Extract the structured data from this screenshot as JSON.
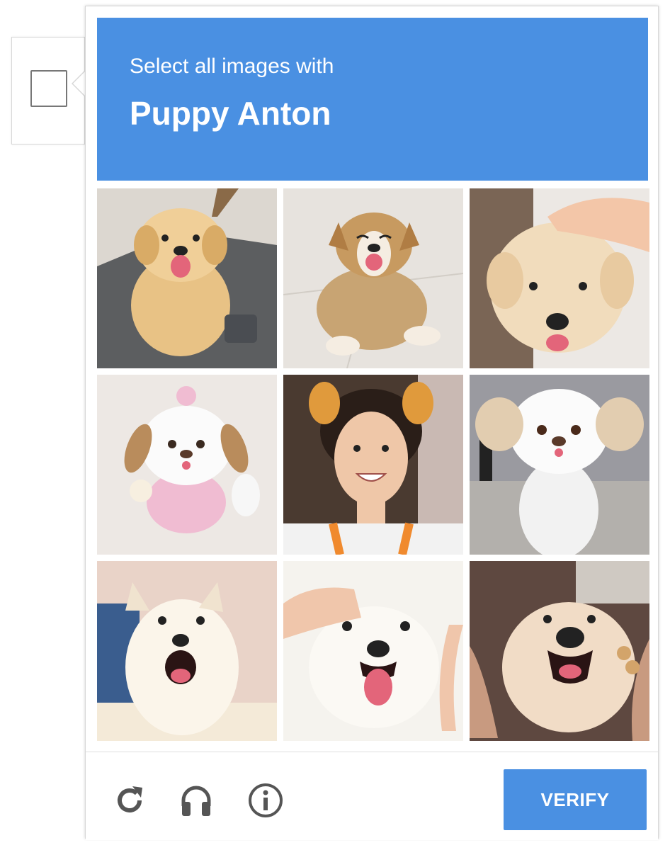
{
  "challenge": {
    "prompt_line1": "Select all images with",
    "prompt_line2": "Puppy Anton"
  },
  "tiles": [
    {
      "subject": "golden fluffy puppy sitting on grey floor with tongue out"
    },
    {
      "subject": "tan and white corgi puppy lying on tile floor"
    },
    {
      "subject": "cream fluffy puppy being petted by a hand"
    },
    {
      "subject": "white plush dog toy with brown ears and pink outfit"
    },
    {
      "subject": "smiling young man with puppy ear filter and orange lanyard"
    },
    {
      "subject": "person in white dog mascot costume"
    },
    {
      "subject": "white fluffy puppy with open mouth"
    },
    {
      "subject": "white fluffy puppy held by hands with tongue out"
    },
    {
      "subject": "cream puppy held by hand with bracelet"
    }
  ],
  "footer": {
    "reload_icon": "reload-icon",
    "audio_icon": "headphones-icon",
    "info_icon": "info-icon",
    "verify_label": "VERIFY"
  },
  "colors": {
    "accent": "#4a90e2",
    "border": "#d7d7d7",
    "icon": "#555555"
  }
}
